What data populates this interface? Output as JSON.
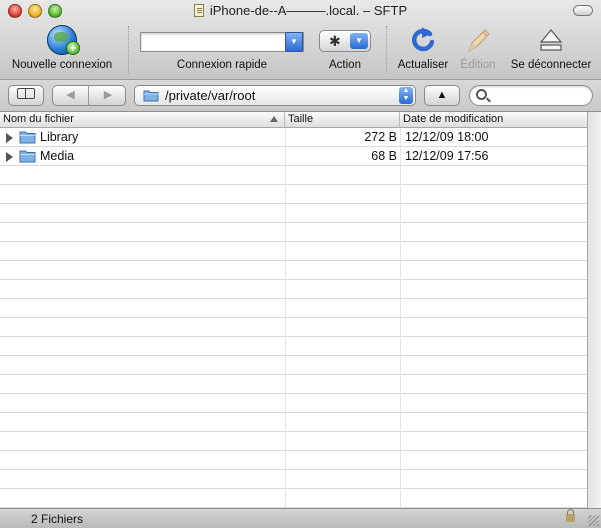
{
  "window": {
    "title": "iPhone-de--A———.local. – SFTP"
  },
  "toolbar": {
    "new_connection_label": "Nouvelle connexion",
    "quick_connect_label": "Connexion rapide",
    "quick_connect_value": "",
    "action_label": "Action",
    "refresh_label": "Actualiser",
    "edit_label": "Édition",
    "disconnect_label": "Se déconnecter"
  },
  "navbar": {
    "path": "/private/var/root",
    "search_value": ""
  },
  "table": {
    "columns": {
      "name": "Nom du fichier",
      "size": "Taille",
      "date": "Date de modification"
    },
    "rows": [
      {
        "name": "Library",
        "size": "272 B",
        "date": "12/12/09 18:00"
      },
      {
        "name": "Media",
        "size": "68 B",
        "date": "12/12/09 17:56"
      }
    ]
  },
  "status": {
    "text": "2 Fichiers"
  },
  "icons": {
    "new_connection": "globe-plus-icon",
    "refresh": "refresh-icon",
    "edit": "pencil-icon",
    "disconnect": "eject-icon",
    "folder": "folder-icon",
    "search": "search-icon",
    "lock": "lock-icon"
  },
  "colors": {
    "accent_blue": "#2c6ad3",
    "folder_blue": "#7fb2e8"
  }
}
